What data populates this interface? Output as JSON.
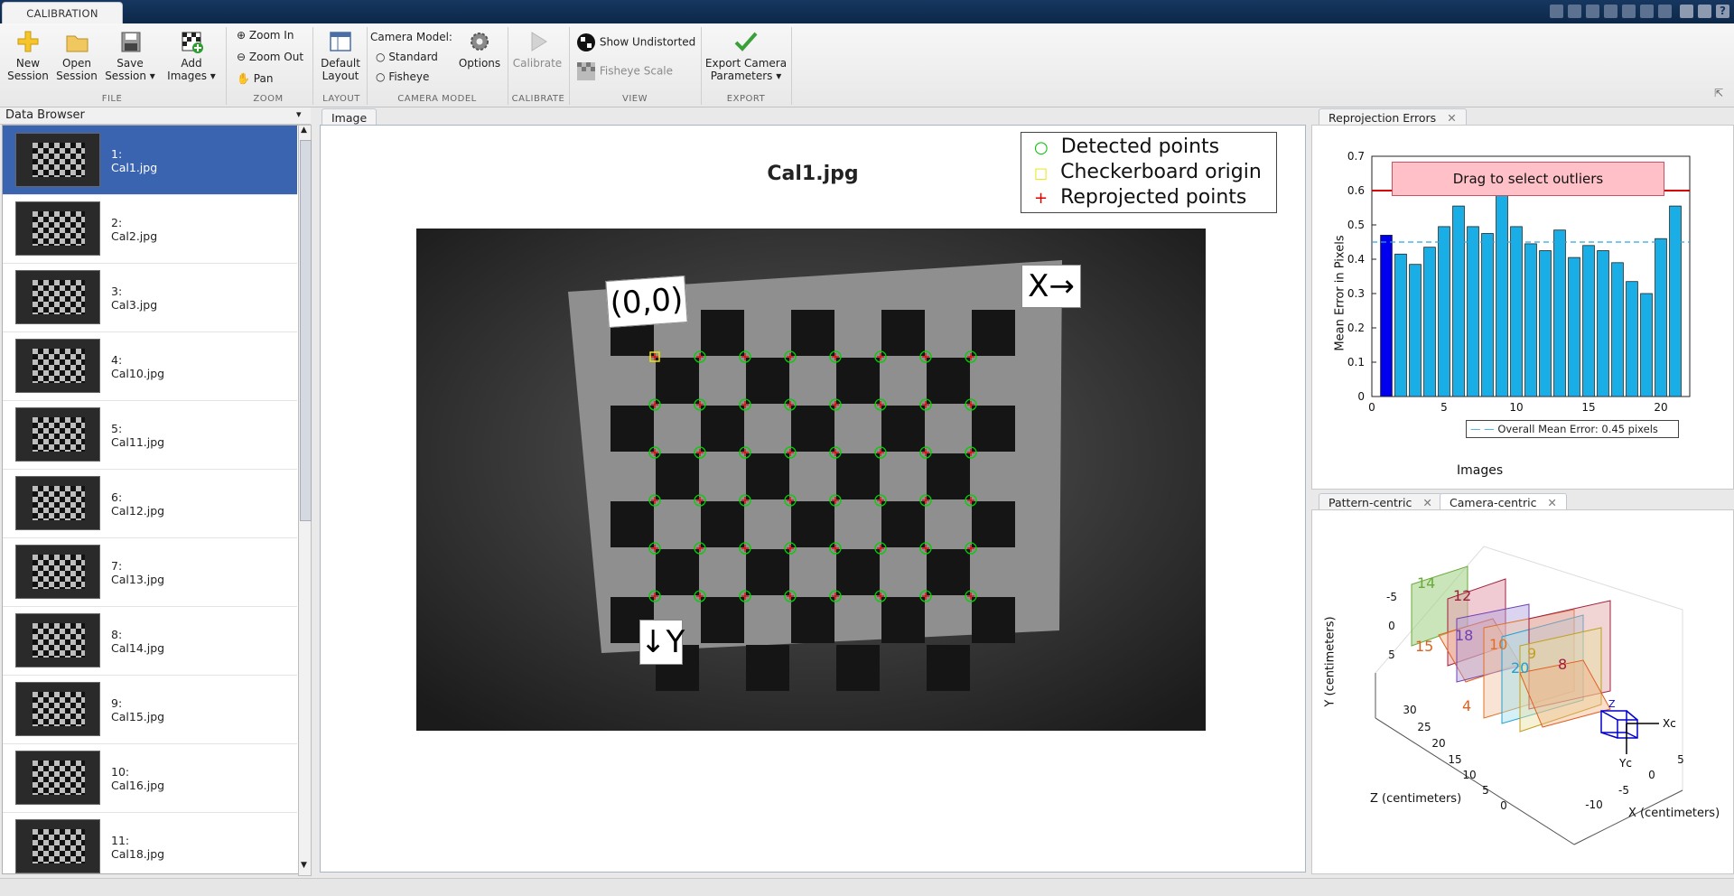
{
  "app": {
    "tab": "CALIBRATION"
  },
  "ribbon": {
    "file": {
      "group": "FILE",
      "new_session": [
        "New",
        "Session"
      ],
      "open_session": [
        "Open",
        "Session"
      ],
      "save_session": [
        "Save",
        "Session ▾"
      ],
      "add_images": [
        "Add",
        "Images ▾"
      ]
    },
    "zoom": {
      "group": "ZOOM",
      "zoom_in": "Zoom In",
      "zoom_out": "Zoom Out",
      "pan": "Pan"
    },
    "layout": {
      "group": "LAYOUT",
      "default_layout": [
        "Default",
        "Layout"
      ]
    },
    "camera_model": {
      "group": "CAMERA MODEL",
      "title": "Camera Model:",
      "standard": "Standard",
      "fisheye": "Fisheye",
      "options": "Options"
    },
    "calibrate": {
      "group": "CALIBRATE",
      "label": "Calibrate"
    },
    "view": {
      "group": "VIEW",
      "show_undistorted": "Show Undistorted",
      "fisheye_scale": "Fisheye Scale"
    },
    "export": {
      "group": "EXPORT",
      "export_camera_parameters": [
        "Export Camera",
        "Parameters ▾"
      ]
    }
  },
  "data_browser": {
    "title": "Data Browser",
    "items": [
      {
        "index": "1:",
        "name": "Cal1.jpg",
        "selected": true
      },
      {
        "index": "2:",
        "name": "Cal2.jpg"
      },
      {
        "index": "3:",
        "name": "Cal3.jpg"
      },
      {
        "index": "4:",
        "name": "Cal10.jpg"
      },
      {
        "index": "5:",
        "name": "Cal11.jpg"
      },
      {
        "index": "6:",
        "name": "Cal12.jpg"
      },
      {
        "index": "7:",
        "name": "Cal13.jpg"
      },
      {
        "index": "8:",
        "name": "Cal14.jpg"
      },
      {
        "index": "9:",
        "name": "Cal15.jpg"
      },
      {
        "index": "10:",
        "name": "Cal16.jpg"
      },
      {
        "index": "11:",
        "name": "Cal18.jpg"
      }
    ]
  },
  "image_panel": {
    "tab": "Image",
    "title": "Cal1.jpg",
    "legend": [
      "Detected points",
      "Checkerboard origin",
      "Reprojected points"
    ],
    "origin_label": "(0,0)",
    "x_axis_label": "X→",
    "y_axis_label": "↓Y"
  },
  "reprojection": {
    "tab": "Reprojection Errors",
    "drag_label": "Drag to select outliers",
    "xlabel": "Images",
    "ylabel": "Mean Error in Pixels",
    "overall": "Overall Mean Error: 0.45 pixels"
  },
  "extrinsics": {
    "tabs": [
      "Pattern-centric",
      "Camera-centric"
    ],
    "ylabel": "Y (centimeters)",
    "zlabel": "Z (centimeters)",
    "xlabel": "X (centimeters)",
    "y_ticks": [
      "-5",
      "0",
      "5"
    ],
    "z_ticks": [
      "30",
      "25",
      "20",
      "15",
      "10",
      "5",
      "0"
    ],
    "x_ticks": [
      "-10",
      "-5",
      "0",
      "5"
    ],
    "pattern_labels": [
      "14",
      "12",
      "15",
      "18",
      "10",
      "9",
      "20",
      "8",
      "4"
    ],
    "camera_axes": [
      "Z",
      "Xc",
      "Yc"
    ]
  },
  "chart_data": {
    "type": "bar",
    "categories": [
      1,
      2,
      3,
      4,
      5,
      6,
      7,
      8,
      9,
      10,
      11,
      12,
      13,
      14,
      15,
      16,
      17,
      18,
      19,
      20,
      21
    ],
    "values": [
      0.47,
      0.415,
      0.385,
      0.435,
      0.495,
      0.555,
      0.495,
      0.475,
      0.6,
      0.495,
      0.445,
      0.425,
      0.485,
      0.405,
      0.44,
      0.425,
      0.39,
      0.335,
      0.3,
      0.46,
      0.555
    ],
    "selected_index": 0,
    "overall_mean": 0.45,
    "threshold": 0.6,
    "xlabel": "Images",
    "ylabel": "Mean Error in Pixels",
    "xlim": [
      0,
      22
    ],
    "ylim": [
      0,
      0.7
    ],
    "xticks": [
      0,
      5,
      10,
      15,
      20
    ],
    "yticks": [
      0,
      0.1,
      0.2,
      0.3,
      0.4,
      0.5,
      0.6,
      0.7
    ],
    "colors": {
      "bar": "#19aee6",
      "selected": "#0000ee",
      "mean": "#2aa7df",
      "threshold": "#d40000",
      "drag_box": "#ffc0c7"
    }
  }
}
